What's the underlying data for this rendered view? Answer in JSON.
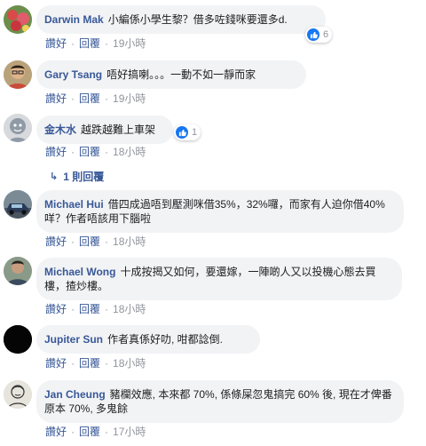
{
  "actions": {
    "like": "讚好",
    "reply": "回覆",
    "dot": "·"
  },
  "comments": [
    {
      "author": "Darwin Mak",
      "text": "小編係小學生黎？借多咗錢咪要還多d.",
      "time": "19小時",
      "reactions": "6",
      "avatar_icon": "flower-photo-avatar"
    },
    {
      "author": "Gary Tsang",
      "text": "唔好搞喇。。。一動不如一靜而家",
      "time": "19小時",
      "avatar_icon": "person-glasses-avatar"
    },
    {
      "author": "金木水",
      "text": "越跌越難上車架",
      "time": "18小時",
      "reactions": "1",
      "avatar_icon": "cartoon-avatar"
    },
    {
      "author": "Michael Hui",
      "text": "借四成過唔到壓測咪借35%，32%囉，而家有人迫你借40%咩？作者唔該用下腦啦",
      "time": "18小時",
      "avatar_icon": "car-photo-avatar"
    },
    {
      "author": "Michael Wong",
      "text": "十成按揭又如何，要還嫁，一陣啲人又以投機心態去買樓，揸炒樓。",
      "time": "18小時",
      "avatar_icon": "person-photo-avatar"
    },
    {
      "author": "Jupiter Sun",
      "text": "作者真係好叻, 咁都諗倒.",
      "time": "18小時",
      "avatar_icon": "black-avatar"
    },
    {
      "author": "Jan Cheung",
      "text": "豬欄效應, 本來都 70%, 係條屎忽鬼搞完 60% 後, 現在才俾番原本 70%, 多鬼餘",
      "time": "17小時",
      "avatar_icon": "sketch-avatar"
    }
  ],
  "reply_link": "1 則回覆",
  "colors": {
    "link": "#385898",
    "bubble": "#f2f3f5",
    "muted": "#90949c",
    "like_blue": "#1877f2"
  }
}
